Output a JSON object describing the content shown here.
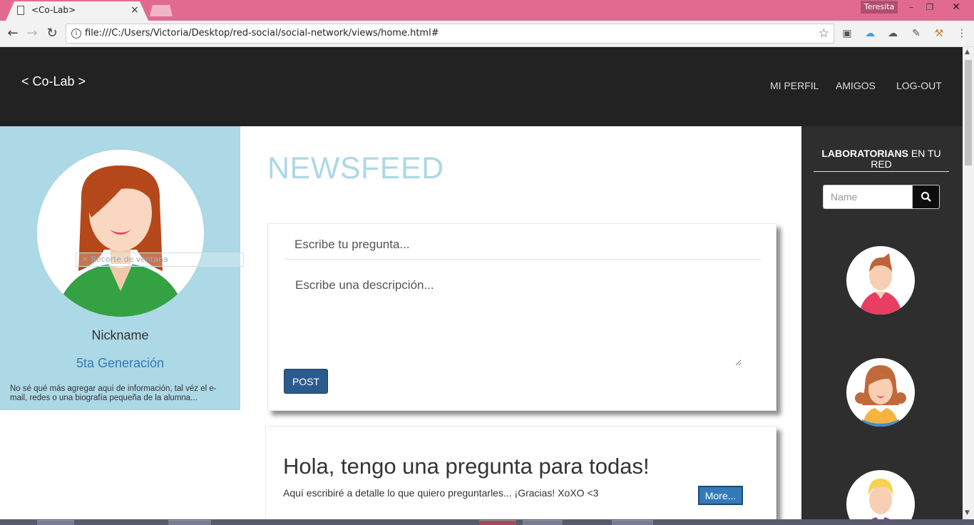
{
  "browser": {
    "tab_title": "<Co-Lab>",
    "tab_close": "×",
    "profile_name": "Teresita",
    "window_minimize": "–",
    "window_restore": "❐",
    "window_close": "✕",
    "back": "←",
    "forward": "→",
    "reload": "↻",
    "url": "file:///C:/Users/Victoria/Desktop/red-social/social-network/views/home.html#",
    "menu": "⋮"
  },
  "header": {
    "brand": "< Co-Lab >",
    "nav": [
      "MI PERFIL",
      "AMIGOS",
      "LOG-OUT"
    ]
  },
  "profile": {
    "snip_label": "× Recorte de ventana",
    "nickname": "Nickname",
    "generation": "5ta Generación",
    "bio": "No sé qué más agregar aquí de información, tal véz el e-mail, redes o una biografía pequeña de la alumna..."
  },
  "feed": {
    "title": "NEWSFEED",
    "question_placeholder": "Escribe tu pregunta...",
    "description_placeholder": "Escribe una descripción...",
    "post_label": "POST",
    "posts": [
      {
        "title": "Hola, tengo una pregunta para todas!",
        "body": "Aquí escribiré a detalle lo que quiero preguntarles... ¡Gracias! XoXO <3",
        "more_label": "More..."
      }
    ]
  },
  "network": {
    "title_bold": "LABORATORIANS",
    "title_rest": " EN TU RED",
    "search_placeholder": "Name"
  },
  "colors": {
    "header_bg": "#222222",
    "profile_bg": "#add8e6",
    "accent_link": "#337ab7",
    "post_button": "#2b5b8c",
    "sidebar_bg": "#2e2e2e",
    "tab_strip": "#e26a91"
  }
}
